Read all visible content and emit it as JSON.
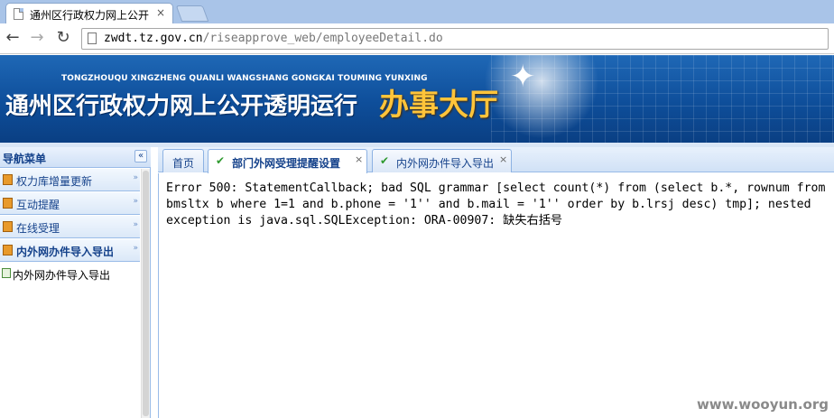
{
  "browser": {
    "tab_title": "通州区行政权力网上公开透明运行",
    "tab_close": "×",
    "back": "←",
    "forward": "→",
    "reload": "↻",
    "url_host": "zwdt.tz.gov.cn",
    "url_path": "/riseapprove_web/employeeDetail.do"
  },
  "banner": {
    "pinyin": "TONGZHOUQU XINGZHENG QUANLI WANGSHANG GONGKAI TOUMING YUNXING",
    "title": "通州区行政权力网上公开透明运行",
    "hall": "办事大厅",
    "star": "✦"
  },
  "sidebar": {
    "title": "导航菜单",
    "collapse": "«",
    "items": [
      {
        "label": "权力库增量更新",
        "chevron": "»"
      },
      {
        "label": "互动提醒",
        "chevron": "»"
      },
      {
        "label": "在线受理",
        "chevron": "»"
      },
      {
        "label": "内外网办件导入导出",
        "chevron": "»"
      }
    ],
    "sub_item": "内外网办件导入导出"
  },
  "content": {
    "tabs": [
      {
        "label": "首页"
      },
      {
        "label": "部门外网受理提醒设置",
        "close": "×",
        "check": "✔"
      },
      {
        "label": "内外网办件导入导出",
        "close": "×",
        "check": "✔"
      }
    ],
    "error_lines": [
      "Error 500: StatementCallback; bad SQL grammar [select count(*) from (select b.*, rownum from",
      "bmsltx b where 1=1 and b.phone = '1'' and b.mail = '1'' order by b.lrsj desc) tmp]; nested",
      "exception is java.sql.SQLException: ORA-00907: 缺失右括号"
    ]
  },
  "watermark": "www.wooyun.org",
  "colors": {
    "banner": "#0e4e9a",
    "hall_text": "#ffc43a",
    "nav_text": "#15428b",
    "panel_border": "#99bbe8"
  }
}
